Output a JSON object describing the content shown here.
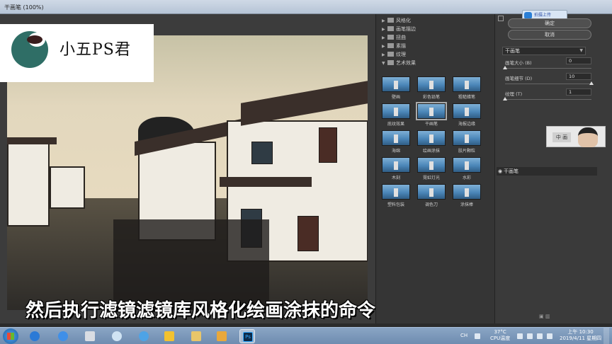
{
  "window": {
    "title": "干画笔 (100%)"
  },
  "logo": {
    "text": "小五PS君"
  },
  "subtitle": "然后执行滤镜滤镜库风格化绘画涂抹的命令",
  "categories": [
    {
      "label": "风格化",
      "expanded": false
    },
    {
      "label": "画笔描边",
      "expanded": false
    },
    {
      "label": "扭曲",
      "expanded": false
    },
    {
      "label": "素描",
      "expanded": false
    },
    {
      "label": "纹理",
      "expanded": false
    },
    {
      "label": "艺术效果",
      "expanded": true
    }
  ],
  "filters": [
    {
      "label": "壁画"
    },
    {
      "label": "彩色铅笔"
    },
    {
      "label": "粗糙蜡笔"
    },
    {
      "label": "底纹效果"
    },
    {
      "label": "干画笔",
      "selected": true
    },
    {
      "label": "海报边缘"
    },
    {
      "label": "海绵"
    },
    {
      "label": "绘画涂抹"
    },
    {
      "label": "胶片颗粒"
    },
    {
      "label": "木刻"
    },
    {
      "label": "霓虹灯光"
    },
    {
      "label": "水彩"
    },
    {
      "label": "塑料包装"
    },
    {
      "label": "调色刀"
    },
    {
      "label": "涂抹棒"
    }
  ],
  "settings": {
    "ok_label": "确定",
    "cancel_label": "取消",
    "upload_label": "拍摄上传",
    "filter_select": "干画笔",
    "params": [
      {
        "label": "画笔大小 (B)",
        "value": "0",
        "fraction": 0.0
      },
      {
        "label": "画笔细节 (D)",
        "value": "10",
        "fraction": 1.0
      },
      {
        "label": "纹理 (T)",
        "value": "1",
        "fraction": 0.0
      }
    ],
    "layer_name": "干画笔",
    "webcam_chip": "中 画"
  },
  "taskbar": {
    "lang": "CH",
    "temp": "37°C",
    "cpu": "CPU温度",
    "time": "上午 10:30",
    "date": "2019/4/11 星期四"
  },
  "colors": {
    "ps_panel": "#353535",
    "logo_green": "#2f6e66",
    "taskbar": "#7a96b8"
  }
}
